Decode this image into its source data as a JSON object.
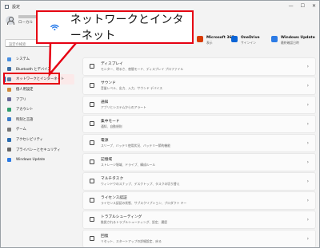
{
  "window": {
    "title": "設定",
    "controls": [
      "—",
      "☐",
      "✕"
    ]
  },
  "user": {
    "name": "ローカル"
  },
  "search": {
    "placeholder": "設定の検索"
  },
  "sidebar": {
    "items": [
      {
        "label": "システム",
        "icon_color": "#4a90e2"
      },
      {
        "label": "Bluetooth とデバイス",
        "icon_color": "#3a6ea5"
      },
      {
        "label": "ネットワークとインターネット",
        "icon_color": "#5b7ea4"
      },
      {
        "label": "個人用設定",
        "icon_color": "#d08a3c"
      },
      {
        "label": "アプリ",
        "icon_color": "#6b6b9a"
      },
      {
        "label": "アカウント",
        "icon_color": "#2f9d6e"
      },
      {
        "label": "時刻と言語",
        "icon_color": "#3b7bc8"
      },
      {
        "label": "ゲーム",
        "icon_color": "#777777"
      },
      {
        "label": "アクセシビリティ",
        "icon_color": "#2b6cb0"
      },
      {
        "label": "プライバシーとセキュリティ",
        "icon_color": "#666666"
      },
      {
        "label": "Windows Update",
        "icon_color": "#2c7be5"
      }
    ]
  },
  "header_apps": [
    {
      "name": "Microsoft 365",
      "sub": "表示",
      "icon_color": "#d83b01"
    },
    {
      "name": "OneDrive",
      "sub": "サインイン",
      "icon_color": "#0a64d6"
    },
    {
      "name": "Windows Update",
      "sub": "最終確認日時",
      "icon_color": "#2c7be5"
    }
  ],
  "settings_rows": [
    {
      "title": "ディスプレイ",
      "desc": "モニター、明るさ、夜間モード、ディスプレイ プロファイル"
    },
    {
      "title": "サウンド",
      "desc": "音量レベル、出力、入力、サウンド デバイス"
    },
    {
      "title": "通知",
      "desc": "アプリとシステムからのアラート"
    },
    {
      "title": "集中モード",
      "desc": "通知、自動規則"
    },
    {
      "title": "電源",
      "desc": "スリープ、バッテリ使用状況、バッテリー節約機能"
    },
    {
      "title": "記憶域",
      "desc": "ストレージ領域、ドライブ、構成ルール"
    },
    {
      "title": "マルチタスク",
      "desc": "ウィンドウのスナップ、デスクトップ、タスクの切り替え"
    },
    {
      "title": "ライセンス認証",
      "desc": "ライセンス認証の状態、サブスクリプション、プロダクト キー"
    },
    {
      "title": "トラブルシューティング",
      "desc": "推奨されるトラブルシューティング、設定、履歴"
    },
    {
      "title": "回復",
      "desc": "リセット、スタートアップの詳細設定、戻る"
    }
  ],
  "callout": {
    "text": "ネットワークとインターネット",
    "highlight_color": "#e60012",
    "wifi_color": "#1a73e8"
  }
}
